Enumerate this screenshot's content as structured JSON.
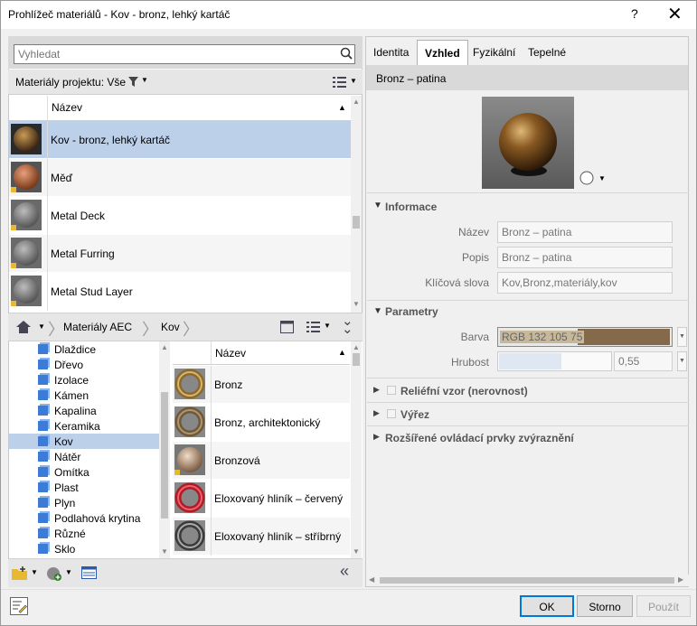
{
  "window": {
    "title": "Prohlížeč materiálů - Kov - bronz, lehký kartáč",
    "help": "?",
    "close": "✕"
  },
  "search": {
    "placeholder": "Vyhledat"
  },
  "project_filter": {
    "label": "Materiály projektu: Vše"
  },
  "project_list": {
    "header": "Název",
    "items": [
      {
        "name": "Kov - bronz, lehký kartáč",
        "color": "#6a4a1e",
        "selected": true
      },
      {
        "name": "Měď",
        "color": "#b8643a"
      },
      {
        "name": "Metal Deck",
        "color": "#8a8a8a"
      },
      {
        "name": "Metal Furring",
        "color": "#8a8a8a"
      },
      {
        "name": "Metal Stud Layer",
        "color": "#8a8a8a"
      }
    ]
  },
  "breadcrumb": {
    "root": "Materiály AEC",
    "child": "Kov"
  },
  "tree": {
    "items": [
      "Dlaždice",
      "Dřevo",
      "Izolace",
      "Kámen",
      "Kapalina",
      "Keramika",
      "Kov",
      "Nátěr",
      "Omítka",
      "Plast",
      "Plyn",
      "Podlahová krytina",
      "Různé",
      "Sklo"
    ],
    "selected": "Kov"
  },
  "library_list": {
    "header": "Název",
    "items": [
      {
        "name": "Bronz",
        "color": "#8a6a2e"
      },
      {
        "name": "Bronz, architektonický",
        "color": "#6e5a3a"
      },
      {
        "name": "Bronzová",
        "color": "#b8987a"
      },
      {
        "name": "Eloxovaný hliník – červený",
        "color": "#b01c24"
      },
      {
        "name": "Eloxovaný hliník – stříbrný",
        "color": "#3a3a3a"
      }
    ]
  },
  "tabs": [
    "Identita",
    "Vzhled",
    "Fyzikální",
    "Tepelné"
  ],
  "active_tab": "Vzhled",
  "asset_name": "Bronz – patina",
  "info": {
    "title": "Informace",
    "name_label": "Název",
    "name_value": "Bronz – patina",
    "desc_label": "Popis",
    "desc_value": "Bronz – patina",
    "keywords_label": "Klíčová slova",
    "keywords_value": "Kov,Bronz,materiály,kov"
  },
  "params": {
    "title": "Parametry",
    "color_label": "Barva",
    "color_value": "RGB 132 105 75",
    "color_hex": "#84694b",
    "rough_label": "Hrubost",
    "rough_value": "0,55",
    "rough_fraction": 0.55
  },
  "sections": {
    "relief": "Reliéfní vzor (nerovnost)",
    "cutout": "Výřez",
    "advanced": "Rozšířené ovládací prvky zvýraznění"
  },
  "buttons": {
    "ok": "OK",
    "cancel": "Storno",
    "apply": "Použít"
  }
}
